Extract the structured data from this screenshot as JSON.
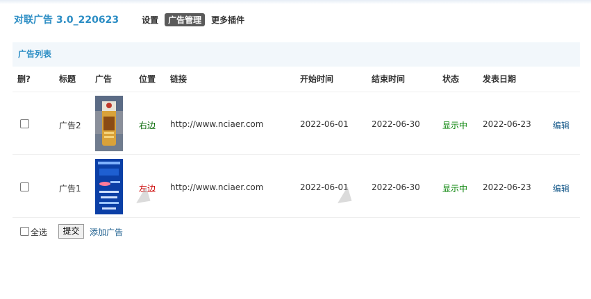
{
  "header": {
    "title": "对联广告 3.0_220623",
    "nav": [
      {
        "label": "设置",
        "active": false
      },
      {
        "label": "广告管理",
        "active": true
      },
      {
        "label": "更多插件",
        "active": false
      }
    ]
  },
  "panel": {
    "title": "广告列表"
  },
  "table": {
    "columns": [
      "删?",
      "标题",
      "广告",
      "位置",
      "链接",
      "开始时间",
      "结束时间",
      "状态",
      "发表日期"
    ],
    "rows": [
      {
        "title": "广告2",
        "position": "右边",
        "link": "http://www.nciaer.com",
        "start": "2022-06-01",
        "end": "2022-06-30",
        "status": "显示中",
        "date": "2022-06-23",
        "action": "编辑"
      },
      {
        "title": "广告1",
        "position": "左边",
        "link": "http://www.nciaer.com",
        "start": "2022-06-01",
        "end": "2022-06-30",
        "status": "显示中",
        "date": "2022-06-23",
        "action": "编辑"
      }
    ]
  },
  "footer": {
    "select_all": "全选",
    "submit": "提交",
    "add": "添加广告"
  },
  "colors": {
    "accent": "#2b8dc4",
    "panel_bg": "#f2f7fb",
    "status_green": "#008000",
    "position_right": "#006600",
    "position_left": "#cc0000",
    "link": "#1a5c8c"
  }
}
